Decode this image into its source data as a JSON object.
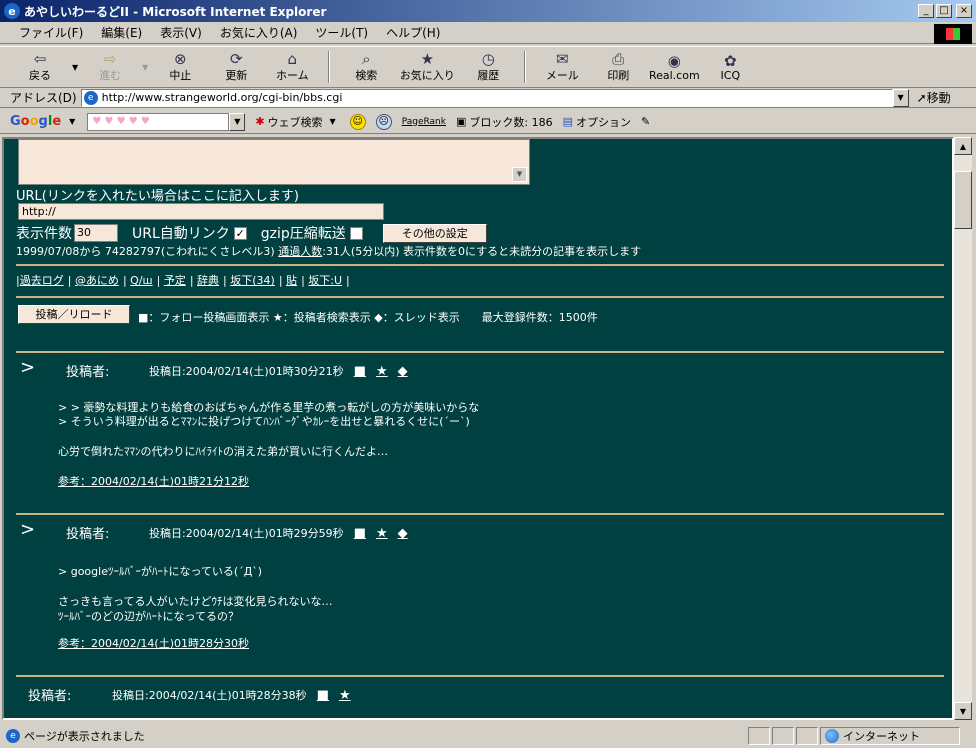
{
  "window": {
    "title": "あやしいわーるどII - Microsoft Internet Explorer",
    "controls": [
      "_",
      "□",
      "×"
    ]
  },
  "menu": [
    "ファイル(F)",
    "編集(E)",
    "表示(V)",
    "お気に入り(A)",
    "ツール(T)",
    "ヘルプ(H)"
  ],
  "toolbar": {
    "back": "戻る",
    "forward": "進む",
    "stop": "中止",
    "refresh": "更新",
    "home": "ホーム",
    "search": "検索",
    "favorites": "お気に入り",
    "history": "履歴",
    "mail": "メール",
    "print": "印刷",
    "realcom": "Real.com",
    "icq": "ICQ"
  },
  "address": {
    "label": "アドレス(D)",
    "url": "http://www.strangeworld.org/cgi-bin/bbs.cgi",
    "go": "移動"
  },
  "google_bar": {
    "logo": [
      "G",
      "o",
      "o",
      "g",
      "l",
      "e"
    ],
    "search_value": "♥ ♥ ♥ ♥ ♥",
    "web_search": "ウェブ検索",
    "pagerank": "PageRank",
    "block_count": "ブロック数: 186",
    "options": "オプション"
  },
  "form": {
    "url_label": "URL(リンクを入れたい場合はここに記入します)",
    "url_value": "http://",
    "count_label": "表示件数",
    "count_value": "30",
    "auto_link_label": "URL自動リンク",
    "auto_link_checked": "✓",
    "gzip_label": "gzip圧縮転送",
    "other_settings": "その他の設定",
    "stat_prefix": "1999/07/08から 74282797(こわれにくさレベル3)",
    "visitors_label": "通過人数",
    "stat_suffix": ":31人(5分以内) 表示件数を0にすると未読分の記事を表示します"
  },
  "links": [
    "過去ログ",
    "@あにめ",
    "Q/ш",
    "予定",
    "辞典",
    "坂下(34)",
    "貼",
    "坂下:U"
  ],
  "post_button": "投稿／リロード",
  "legend": "■：フォロー投稿画面表示 ★：投稿者検索表示 ◆：スレッド表示　　最大登録件数：1500件",
  "posts": [
    {
      "arrow": ">",
      "author_label": "投稿者:",
      "date": "投稿日:2004/02/14(土)01時30分21秒",
      "marks": [
        "■",
        "★",
        "◆"
      ],
      "lines": [
        "> > 豪勢な料理よりも給食のおばちゃんが作る里芋の煮っ転がしの方が美味いからな",
        "> そういう料理が出るとﾏﾏﾝに投げつけてﾊﾝﾊﾞｰｸﾞやｶﾚｰを出せと暴れるくせに(´ー`)",
        "",
        "心労で倒れたﾏﾏﾝの代わりにﾊｲﾗｲﾄの消えた弟が買いに行くんだよ…"
      ],
      "ref": "参考：2004/02/14(土)01時21分12秒"
    },
    {
      "arrow": ">",
      "author_label": "投稿者:",
      "date": "投稿日:2004/02/14(土)01時29分59秒",
      "marks": [
        "■",
        "★",
        "◆"
      ],
      "lines": [
        "> googleﾂｰﾙﾊﾞｰがﾊｰﾄになっている(´Д`)",
        "",
        "さっきも言ってる人がいたけどｳﾁは変化見られないな…",
        "ﾂｰﾙﾊﾞｰのどの辺がﾊｰﾄになってるの？"
      ],
      "ref": "参考：2004/02/14(土)01時28分30秒"
    },
    {
      "author_label": "投稿者:",
      "date": "投稿日:2004/02/14(土)01時28分38秒",
      "marks": [
        "■",
        "★"
      ]
    }
  ],
  "status": {
    "text": "ページが表示されました",
    "zone": "インターネット"
  }
}
